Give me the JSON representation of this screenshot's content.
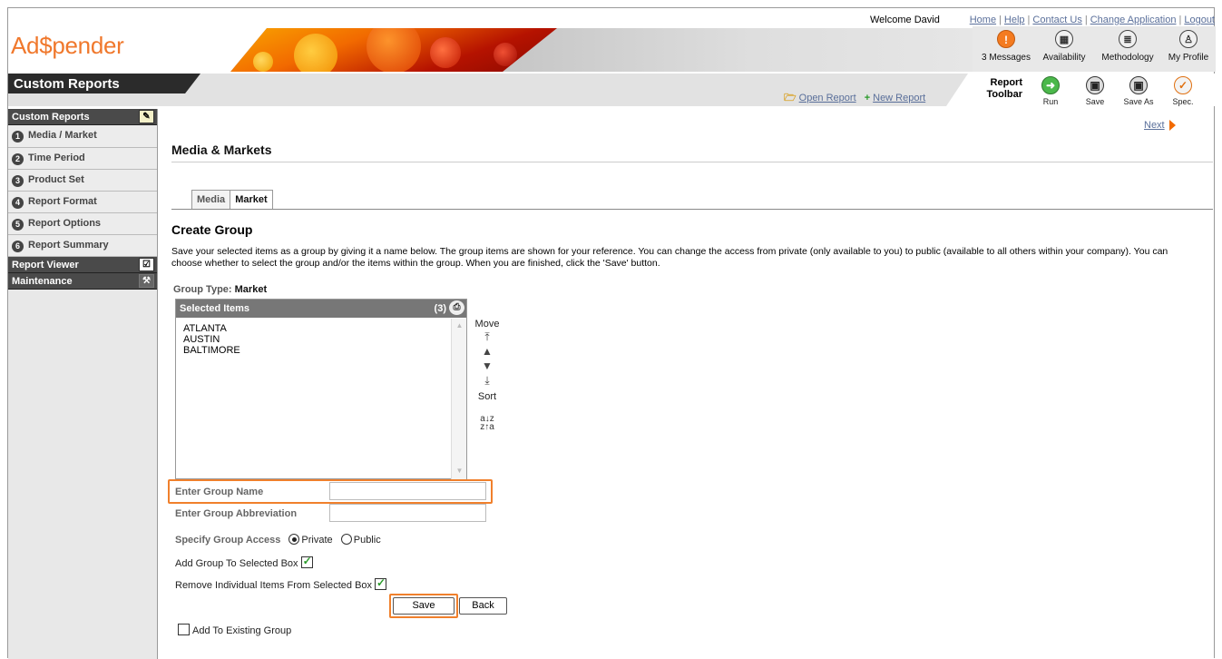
{
  "top_links": {
    "welcome": "Welcome David",
    "links": [
      "Home",
      "Help",
      "Contact Us",
      "Change Application",
      "Logout"
    ]
  },
  "brand": {
    "logo": "Ad$pender",
    "accent": "#f0782c"
  },
  "top_icons": [
    {
      "label": "3 Messages",
      "icon": "exclamation-icon"
    },
    {
      "label": "Availability",
      "icon": "calculator-icon"
    },
    {
      "label": "Methodology",
      "icon": "document-icon"
    },
    {
      "label": "My Profile",
      "icon": "person-icon"
    }
  ],
  "section": {
    "title": "Custom Reports",
    "open_report": "Open Report",
    "new_report": "New Report",
    "toolbar_label": "Report\nToolbar",
    "toolbar_buttons": [
      "Run",
      "Save",
      "Save As",
      "Spec."
    ]
  },
  "nav": {
    "custom_reports": "Custom Reports",
    "items": [
      {
        "num": "1",
        "label": "Media / Market"
      },
      {
        "num": "2",
        "label": "Time Period"
      },
      {
        "num": "3",
        "label": "Product Set"
      },
      {
        "num": "4",
        "label": "Report Format"
      },
      {
        "num": "5",
        "label": "Report Options"
      },
      {
        "num": "6",
        "label": "Report Summary"
      }
    ],
    "report_viewer": "Report Viewer",
    "maintenance": "Maintenance"
  },
  "main": {
    "next": "Next",
    "title": "Media & Markets",
    "tabs": [
      "Media",
      "Market"
    ],
    "section_head": "Create Group",
    "description": "Save your selected items as a group by giving it a name below. The group items are shown for your reference. You can change the access from private (only available to you) to public (available to all others within your company). You can choose whether to select the group and/or the items within the group. When you are finished, click the 'Save' button.",
    "group_type_label": "Group Type:",
    "group_type_value": "Market",
    "selected_items_label": "Selected Items",
    "selected_count": "(3)",
    "selected_items": [
      "ATLANTA",
      "AUSTIN",
      "BALTIMORE"
    ],
    "move_label": "Move",
    "sort_label": "Sort",
    "sort_az": "a↓z",
    "sort_za": "z↑a",
    "group_name_label": "Enter Group Name",
    "group_name_value": "",
    "group_abbrev_label": "Enter Group Abbreviation",
    "group_abbrev_value": "",
    "access_label": "Specify Group Access",
    "access_private": "Private",
    "access_public": "Public",
    "add_group_label": "Add Group To Selected Box",
    "remove_items_label": "Remove Individual Items From Selected Box",
    "save_label": "Save",
    "back_label": "Back",
    "add_existing_label": "Add To Existing Group"
  }
}
